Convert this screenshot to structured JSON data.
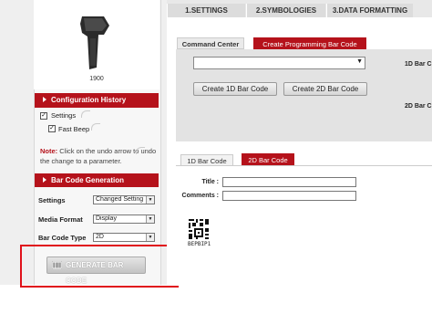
{
  "product": {
    "model": "1900"
  },
  "top_tabs": [
    "1.SETTINGS",
    "2.SYMBOLOGIES",
    "3.DATA FORMATTING"
  ],
  "config_history": {
    "title": "Configuration History",
    "items": [
      {
        "label": "Settings",
        "checked": true
      },
      {
        "label": "Fast Beep",
        "checked": true
      }
    ],
    "note_prefix": "Note:",
    "note_text": " Click on the undo arrow     to undo the change to a parameter."
  },
  "barcode_generation": {
    "title": "Bar Code Generation",
    "fields": [
      {
        "label": "Settings",
        "value": "Changed Setting"
      },
      {
        "label": "Media Format",
        "value": "Display"
      },
      {
        "label": "Bar Code Type",
        "value": "2D"
      }
    ],
    "generate_label": "GENERATE BAR CODE"
  },
  "command_tabs": [
    "Command Center",
    "Create Programming Bar Code"
  ],
  "command_center": {
    "dropdown_value": "",
    "create_1d_label": "Create 1D Bar Code",
    "create_2d_label": "Create 2D Bar Code",
    "label_1d": "1D Bar C",
    "label_2d": "2D Bar C"
  },
  "barcode_tabs": [
    "1D Bar Code",
    "2D Bar Code"
  ],
  "barcode_form": {
    "title_label": "Title :",
    "title_value": "",
    "comments_label": "Comments :",
    "comments_value": "",
    "barcode_caption": "BEPBIP1"
  },
  "colors": {
    "accent": "#b5121b",
    "highlight": "#e0101a"
  }
}
